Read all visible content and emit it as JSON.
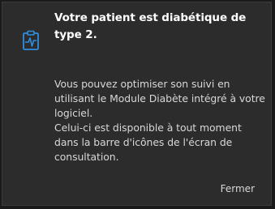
{
  "notification": {
    "icon": "clipboard-pulse-icon",
    "accent_color": "#2f8ee0",
    "title": "Votre patient est diabétique de type 2.",
    "body_line1": "Vous pouvez optimiser son suivi en utilisant le Module Diabète intégré à votre logiciel.",
    "body_line2": "Celui-ci est disponible à tout moment dans la barre d'icônes de l'écran de consultation.",
    "close_label": "Fermer"
  }
}
